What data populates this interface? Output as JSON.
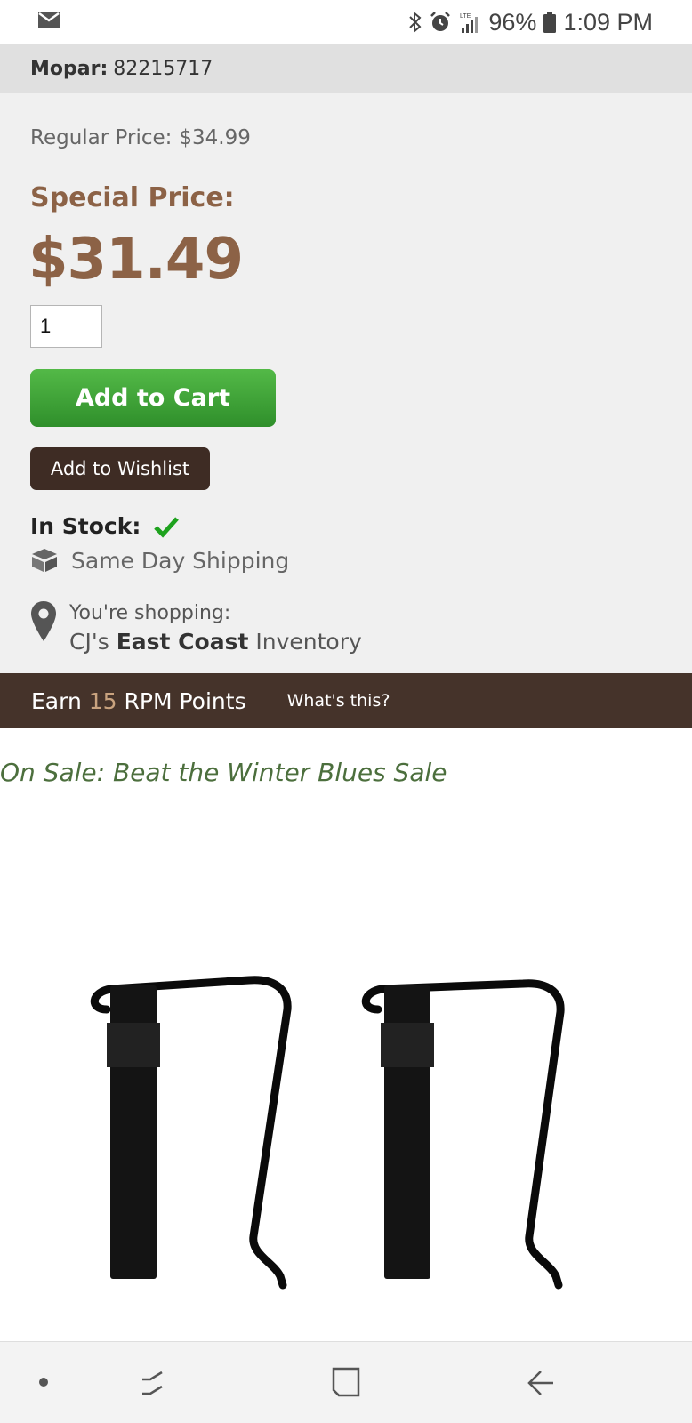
{
  "status_bar": {
    "battery": "96%",
    "time": "1:09 PM",
    "network": "LTE"
  },
  "part": {
    "brand_label": "Mopar:",
    "part_number": "82215717"
  },
  "pricing": {
    "regular_label": "Regular Price:",
    "regular_value": "$34.99",
    "special_label": "Special Price:",
    "special_value": "$31.49"
  },
  "quantity": {
    "value": "1"
  },
  "buttons": {
    "add_to_cart": "Add to Cart",
    "add_to_wishlist": "Add to Wishlist"
  },
  "stock": {
    "label": "In Stock:",
    "shipping": "Same Day Shipping"
  },
  "location": {
    "line1": "You're shopping:",
    "prefix": "CJ's",
    "region": "East Coast",
    "suffix": "Inventory"
  },
  "points": {
    "earn": "Earn",
    "count": "15",
    "label": "RPM Points",
    "whats_this": "What's this?"
  },
  "sale": {
    "text": "On Sale: Beat the Winter Blues Sale"
  },
  "colors": {
    "price_brown": "#8c6246",
    "cart_green": "#3aa036",
    "dark_brown": "#45332a",
    "sale_green": "#4c6f3d",
    "check_green": "#1ea21e"
  },
  "icons": [
    "mail-icon",
    "bluetooth-icon",
    "alarm-icon",
    "signal-icon",
    "battery-icon",
    "checkmark-icon",
    "box-icon",
    "location-pin-icon",
    "recent-apps-icon",
    "home-icon",
    "back-icon"
  ]
}
